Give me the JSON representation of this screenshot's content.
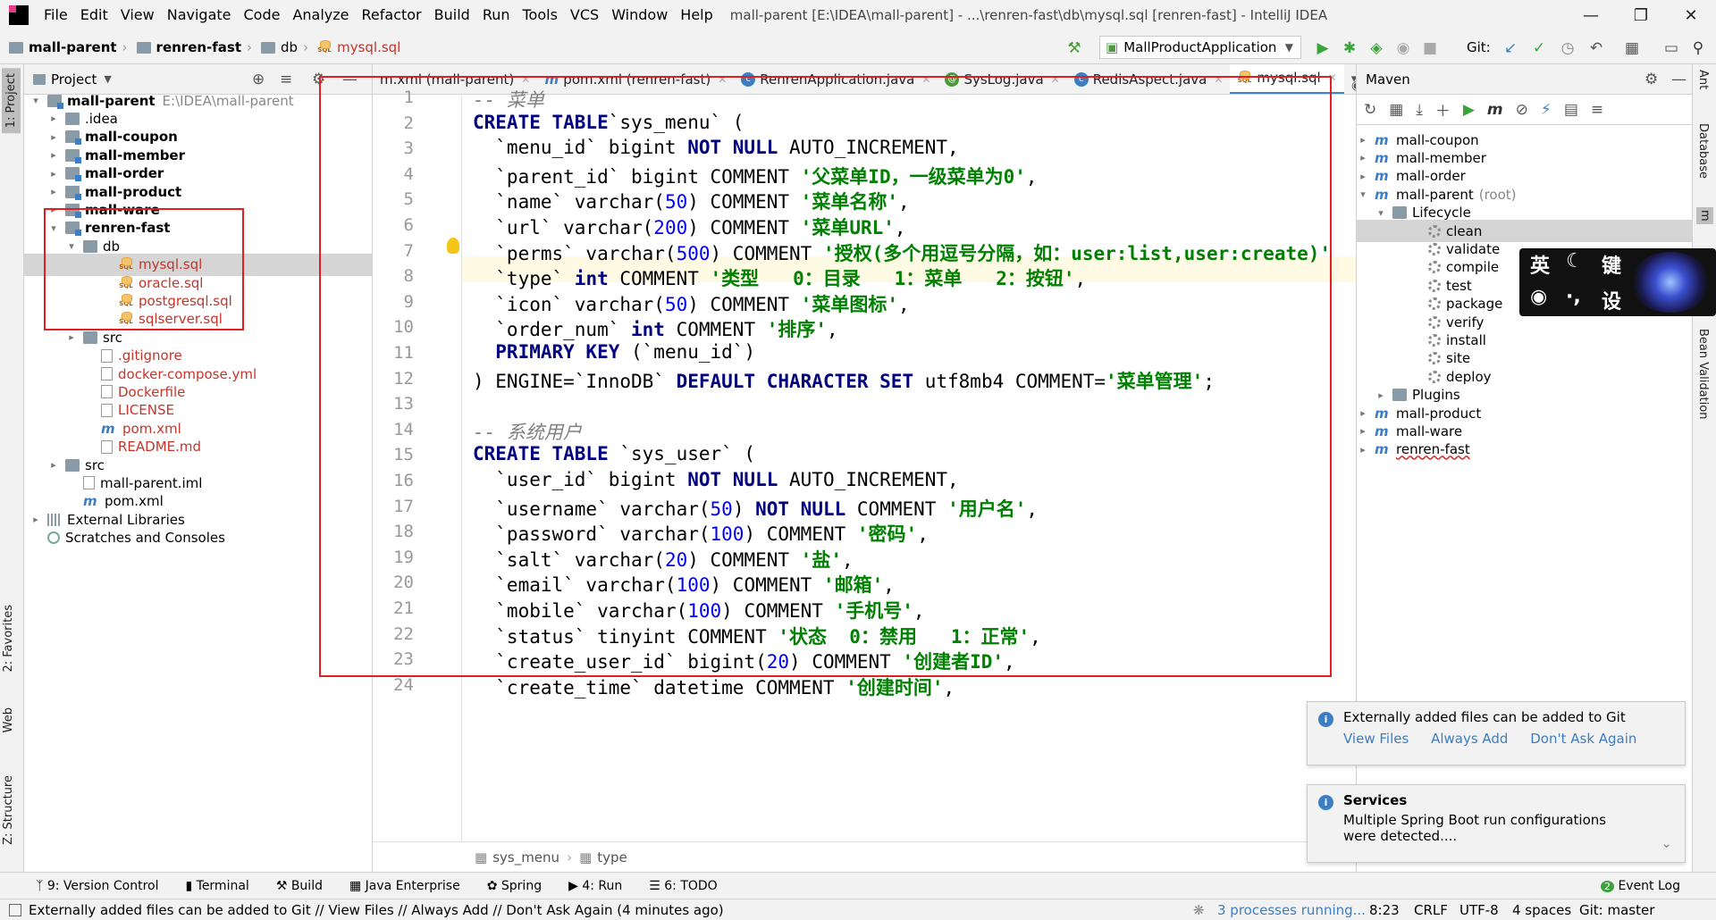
{
  "menu": {
    "items": [
      "File",
      "Edit",
      "View",
      "Navigate",
      "Code",
      "Analyze",
      "Refactor",
      "Build",
      "Run",
      "Tools",
      "VCS",
      "Window",
      "Help"
    ],
    "title": "mall-parent [E:\\IDEA\\mall-parent] - ...\\renren-fast\\db\\mysql.sql [renren-fast] - IntelliJ IDEA"
  },
  "nav": {
    "crumbs": [
      "mall-parent",
      "renren-fast",
      "db",
      "mysql.sql"
    ],
    "run_config": "MallProductApplication",
    "git_label": "Git:"
  },
  "project": {
    "title": "Project",
    "root_name": "mall-parent",
    "root_path": "E:\\IDEA\\mall-parent",
    "items": [
      ".idea",
      "mall-coupon",
      "mall-member",
      "mall-order",
      "mall-product",
      "mall-ware",
      "renren-fast",
      "db",
      "mysql.sql",
      "oracle.sql",
      "postgresql.sql",
      "sqlserver.sql",
      "src",
      ".gitignore",
      "docker-compose.yml",
      "Dockerfile",
      "LICENSE",
      "pom.xml",
      "README.md",
      "src",
      "mall-parent.iml",
      "pom.xml",
      "External Libraries",
      "Scratches and Consoles"
    ]
  },
  "tabs": [
    "m.xml (mall-parent)",
    "pom.xml (renren-fast)",
    "RenrenApplication.java",
    "SysLog.java",
    "RedisAspect.java",
    "mysql.sql"
  ],
  "tabs_overflow": "5",
  "code": {
    "line_numbers": [
      "1",
      "2",
      "3",
      "4",
      "5",
      "6",
      "7",
      "8",
      "9",
      "10",
      "11",
      "12",
      "13",
      "14",
      "15",
      "16",
      "17",
      "18",
      "19",
      "20",
      "21",
      "22",
      "23",
      "24"
    ],
    "lines": [
      [
        [
          "cm",
          "-- 菜单"
        ]
      ],
      [
        [
          "kw",
          "CREATE TABLE"
        ],
        [
          "",
          "`sys_menu` ("
        ]
      ],
      [
        [
          "",
          "  `menu_id` bigint "
        ],
        [
          "kw",
          "NOT NULL"
        ],
        [
          "",
          " AUTO_INCREMENT,"
        ]
      ],
      [
        [
          "",
          "  `parent_id` bigint COMMENT "
        ],
        [
          "str",
          "'父菜单ID，一级菜单为0'"
        ],
        [
          "",
          ","
        ]
      ],
      [
        [
          "",
          "  `name` varchar("
        ],
        [
          "num",
          "50"
        ],
        [
          "",
          ") COMMENT "
        ],
        [
          "str",
          "'菜单名称'"
        ],
        [
          "",
          ","
        ]
      ],
      [
        [
          "",
          "  `url` varchar("
        ],
        [
          "num",
          "200"
        ],
        [
          "",
          ") COMMENT "
        ],
        [
          "str",
          "'菜单URL'"
        ],
        [
          "",
          ","
        ]
      ],
      [
        [
          "",
          "  `perms` varchar("
        ],
        [
          "num",
          "500"
        ],
        [
          "",
          ") COMMENT "
        ],
        [
          "str",
          "'授权(多个用逗号分隔，如：user:list,user:create)'"
        ]
      ],
      [
        [
          "",
          "  `type` "
        ],
        [
          "kw",
          "int"
        ],
        [
          "",
          " COMMENT "
        ],
        [
          "str",
          "'类型   0：目录   1：菜单   2：按钮'"
        ],
        [
          "",
          ","
        ]
      ],
      [
        [
          "",
          "  `icon` varchar("
        ],
        [
          "num",
          "50"
        ],
        [
          "",
          ") COMMENT "
        ],
        [
          "str",
          "'菜单图标'"
        ],
        [
          "",
          ","
        ]
      ],
      [
        [
          "",
          "  `order_num` "
        ],
        [
          "kw",
          "int"
        ],
        [
          "",
          " COMMENT "
        ],
        [
          "str",
          "'排序'"
        ],
        [
          "",
          ","
        ]
      ],
      [
        [
          "kw",
          "  PRIMARY KEY"
        ],
        [
          "",
          " (`menu_id`)"
        ]
      ],
      [
        [
          "",
          ") ENGINE=`InnoDB` "
        ],
        [
          "kw",
          "DEFAULT CHARACTER SET"
        ],
        [
          "",
          " utf8mb4 COMMENT="
        ],
        [
          "str",
          "'菜单管理'"
        ],
        [
          "",
          ";"
        ]
      ],
      [
        [
          "",
          ""
        ]
      ],
      [
        [
          "cm",
          "-- 系统用户"
        ]
      ],
      [
        [
          "kw",
          "CREATE TABLE"
        ],
        [
          "",
          " `sys_user` ("
        ]
      ],
      [
        [
          "",
          "  `user_id` bigint "
        ],
        [
          "kw",
          "NOT NULL"
        ],
        [
          "",
          " AUTO_INCREMENT,"
        ]
      ],
      [
        [
          "",
          "  `username` varchar("
        ],
        [
          "num",
          "50"
        ],
        [
          ") "
        ],
        [
          "kw",
          "NOT NULL"
        ],
        [
          "",
          " COMMENT "
        ],
        [
          "str",
          "'用户名'"
        ],
        [
          "",
          ","
        ]
      ],
      [
        [
          "",
          "  `password` varchar("
        ],
        [
          "num",
          "100"
        ],
        [
          "",
          ") COMMENT "
        ],
        [
          "str",
          "'密码'"
        ],
        [
          "",
          ","
        ]
      ],
      [
        [
          "",
          "  `salt` varchar("
        ],
        [
          "num",
          "20"
        ],
        [
          "",
          ") COMMENT "
        ],
        [
          "str",
          "'盐'"
        ],
        [
          "",
          ","
        ]
      ],
      [
        [
          "",
          "  `email` varchar("
        ],
        [
          "num",
          "100"
        ],
        [
          "",
          ") COMMENT "
        ],
        [
          "str",
          "'邮箱'"
        ],
        [
          "",
          ","
        ]
      ],
      [
        [
          "",
          "  `mobile` varchar("
        ],
        [
          "num",
          "100"
        ],
        [
          "",
          ") COMMENT "
        ],
        [
          "str",
          "'手机号'"
        ],
        [
          "",
          ","
        ]
      ],
      [
        [
          "",
          "  `status` tinyint COMMENT "
        ],
        [
          "str",
          "'状态  0：禁用   1：正常'"
        ],
        [
          "",
          ","
        ]
      ],
      [
        [
          "",
          "  `create_user_id` bigint("
        ],
        [
          "num",
          "20"
        ],
        [
          "",
          ") COMMENT "
        ],
        [
          "str",
          "'创建者ID'"
        ],
        [
          "",
          ","
        ]
      ],
      [
        [
          "",
          "  `create_time` datetime COMMENT "
        ],
        [
          "str",
          "'创建时间'"
        ],
        [
          "",
          ","
        ]
      ]
    ]
  },
  "editor_crumbs": [
    "sys_menu",
    "type"
  ],
  "maven": {
    "title": "Maven",
    "rows": [
      "mall-coupon",
      "mall-member",
      "mall-order",
      "mall-parent",
      "(root)",
      "Lifecycle",
      "clean",
      "validate",
      "compile",
      "test",
      "package",
      "verify",
      "install",
      "site",
      "deploy",
      "Plugins",
      "mall-product",
      "mall-ware",
      "renren-fast"
    ]
  },
  "notifications": [
    {
      "text": "Externally added files can be added to Git",
      "links": [
        "View Files",
        "Always Add",
        "Don't Ask Again"
      ]
    },
    {
      "title": "Services",
      "text": "Multiple Spring Boot run configurations were detected...."
    }
  ],
  "ime": {
    "chars": [
      "英",
      "键",
      "设"
    ]
  },
  "side_tabs": {
    "left": [
      "1: Project",
      "2: Favorites",
      "Web",
      "Z: Structure"
    ],
    "right": [
      "Ant",
      "Database",
      "Bean Validation"
    ]
  },
  "tool_windows": [
    "9: Version Control",
    "Terminal",
    "Build",
    "Java Enterprise",
    "Spring",
    "4: Run",
    "6: TODO",
    "Event Log"
  ],
  "status": {
    "message": "Externally added files can be added to Git // View Files // Always Add // Don't Ask Again (4 minutes ago)",
    "processes": "3 processes running...",
    "position": "8:23",
    "line_sep": "CRLF",
    "encoding": "UTF-8",
    "indent": "4 spaces",
    "git": "Git: master"
  }
}
